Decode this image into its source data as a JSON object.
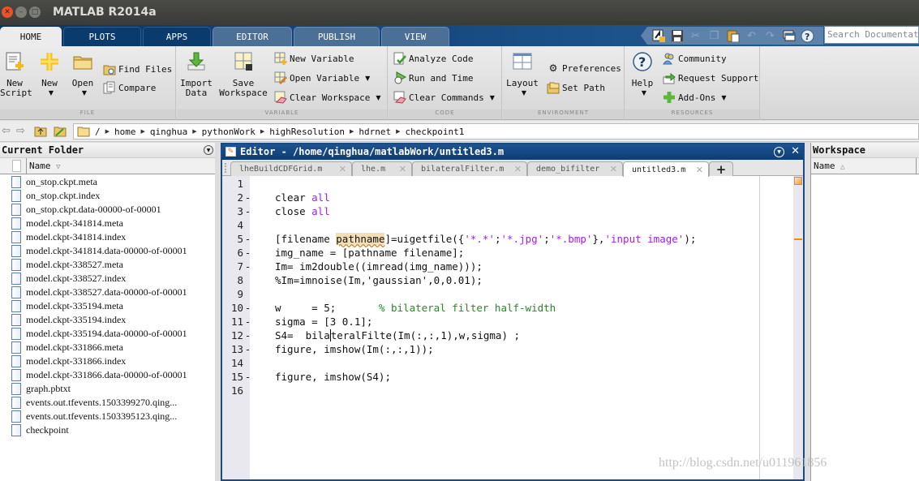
{
  "window": {
    "title": "MATLAB R2014a",
    "controls": [
      "close",
      "minimize",
      "maximize"
    ]
  },
  "ribbon_tabs": [
    {
      "label": "HOME",
      "active": true
    },
    {
      "label": "PLOTS",
      "active": false
    },
    {
      "label": "APPS",
      "active": false
    },
    {
      "label": "EDITOR",
      "active": false
    },
    {
      "label": "PUBLISH",
      "active": false
    },
    {
      "label": "VIEW",
      "active": false
    }
  ],
  "quick_access": {
    "icons": [
      "new-simulink-icon",
      "save-icon",
      "cut-icon",
      "copy-icon",
      "paste-icon",
      "undo-icon",
      "redo-icon",
      "switch-windows-icon",
      "help-icon"
    ],
    "search_placeholder": "Search Documentation"
  },
  "ribbon": {
    "file": {
      "label": "FILE",
      "new_script": "New\nScript",
      "new_script_l1": "New",
      "new_script_l2": "Script",
      "new": "New",
      "open": "Open",
      "find_files": "Find Files",
      "compare": "Compare"
    },
    "variable": {
      "label": "VARIABLE",
      "import_l1": "Import",
      "import_l2": "Data",
      "save_l1": "Save",
      "save_l2": "Workspace",
      "new_variable": "New Variable",
      "open_variable": "Open Variable",
      "clear_workspace": "Clear Workspace"
    },
    "code": {
      "label": "CODE",
      "analyze_code": "Analyze Code",
      "run_and_time": "Run and Time",
      "clear_commands": "Clear Commands"
    },
    "environment": {
      "label": "ENVIRONMENT",
      "layout": "Layout",
      "preferences": "Preferences",
      "set_path": "Set Path"
    },
    "resources": {
      "label": "RESOURCES",
      "help": "Help",
      "community": "Community",
      "request_support": "Request Support",
      "add_ons": "Add-Ons"
    }
  },
  "address_bar": {
    "root": "/",
    "path": [
      "home",
      "qinghua",
      "pythonWork",
      "highResolution",
      "hdrnet",
      "checkpoint1"
    ]
  },
  "current_folder": {
    "title": "Current Folder",
    "column": "Name",
    "sort_indicator": "▽",
    "files": [
      "on_stop.ckpt.meta",
      "on_stop.ckpt.index",
      "on_stop.ckpt.data-00000-of-00001",
      "model.ckpt-341814.meta",
      "model.ckpt-341814.index",
      "model.ckpt-341814.data-00000-of-00001",
      "model.ckpt-338527.meta",
      "model.ckpt-338527.index",
      "model.ckpt-338527.data-00000-of-00001",
      "model.ckpt-335194.meta",
      "model.ckpt-335194.index",
      "model.ckpt-335194.data-00000-of-00001",
      "model.ckpt-331866.meta",
      "model.ckpt-331866.index",
      "model.ckpt-331866.data-00000-of-00001",
      "graph.pbtxt",
      "events.out.tfevents.1503399270.qing...",
      "events.out.tfevents.1503395123.qing...",
      "checkpoint"
    ]
  },
  "editor": {
    "title": "Editor - /home/qinghua/matlabWork/untitled3.m",
    "tabs": [
      {
        "label": "lheBuildCDFGrid.m",
        "active": false
      },
      {
        "label": "lhe.m",
        "active": false
      },
      {
        "label": "bilateralFilter.m",
        "active": false
      },
      {
        "label": "demo_bifilter",
        "active": false
      },
      {
        "label": "untitled3.m",
        "active": true
      }
    ],
    "add_tab": "+",
    "lines": [
      {
        "n": "1",
        "exec": false,
        "code": ""
      },
      {
        "n": "2",
        "exec": true,
        "code": "clear all"
      },
      {
        "n": "3",
        "exec": true,
        "code": "close all"
      },
      {
        "n": "4",
        "exec": false,
        "code": ""
      },
      {
        "n": "5",
        "exec": true,
        "code": "[filename pathname]=uigetfile({'*.*';'*.jpg';'*.bmp'},'input image');"
      },
      {
        "n": "6",
        "exec": true,
        "code": "img_name = [pathname filename];"
      },
      {
        "n": "7",
        "exec": true,
        "code": "Im= im2double((imread(img_name)));"
      },
      {
        "n": "8",
        "exec": false,
        "code": "%Im=imnoise(Im,'gaussian',0,0.01);"
      },
      {
        "n": "9",
        "exec": false,
        "code": ""
      },
      {
        "n": "10",
        "exec": true,
        "code": "w     = 5;       % bilateral filter half-width"
      },
      {
        "n": "11",
        "exec": true,
        "code": "sigma = [3 0.1];"
      },
      {
        "n": "12",
        "exec": true,
        "code": "S4=  bilateralFilte(Im(:,:,1),w,sigma) ;"
      },
      {
        "n": "13",
        "exec": true,
        "code": "figure, imshow(Im(:,:,1));"
      },
      {
        "n": "14",
        "exec": false,
        "code": ""
      },
      {
        "n": "15",
        "exec": true,
        "code": "figure, imshow(S4);"
      },
      {
        "n": "16",
        "exec": false,
        "code": ""
      }
    ],
    "tokens": {
      "l2a": "clear ",
      "l2b": "all",
      "l3a": "close ",
      "l3b": "all",
      "l5a": "[filename ",
      "l5hl": "pathname",
      "l5b": "]=uigetfile({",
      "l5s1": "'*.*'",
      "l5c": ";",
      "l5s2": "'*.jpg'",
      "l5d": ";",
      "l5s3": "'*.bmp'",
      "l5e": "},",
      "l5s4": "'input image'",
      "l5f": ");",
      "l6": "img_name = [pathname filename];",
      "l7": "Im= im2double((imread(img_name)));",
      "l8": "%Im=imnoise(Im,'gaussian',0,0.01);",
      "l10a": "w     = 5;       ",
      "l10c": "% bilateral filter half-width",
      "l11": "sigma = [3 0.1];",
      "l12a": "S4=  bila",
      "l12b": "teralFilte(Im(:,:,1),w,sigma) ;",
      "l13": "figure, imshow(Im(:,:,1));",
      "l15": "figure, imshow(S4);"
    },
    "colors": {
      "keyword": "#a020f0",
      "string": "#a020f0",
      "comment": "#228b22",
      "warning": "#f08c10"
    }
  },
  "workspace": {
    "title": "Workspace",
    "column": "Name",
    "sort_indicator": "△"
  },
  "watermark": "http://blog.csdn.net/u011961856"
}
